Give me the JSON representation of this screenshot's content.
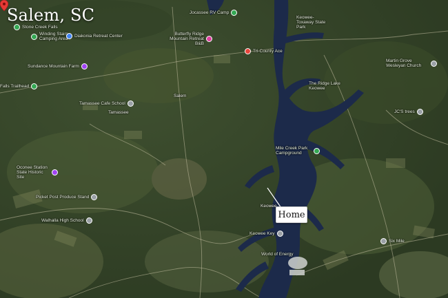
{
  "title": "Salem, SC",
  "marker": {
    "label": "Home"
  },
  "pois": [
    {
      "name": "Stone Creek Falls",
      "color": "#34a853"
    },
    {
      "name": "Winding Stairs Camping Area",
      "color": "#34a853"
    },
    {
      "name": "Diakonia Retreat Center",
      "color": "#4285f4"
    },
    {
      "name": "Butterfly Ridge Mountain Retreat B&B",
      "color": "#e040a0"
    },
    {
      "name": "Sundance Mountain Farm",
      "color": "#a142f4"
    },
    {
      "name": "Jocassee RV Camp",
      "color": "#34a853"
    },
    {
      "name": "Tri-County Ace",
      "color": "#e8453c"
    },
    {
      "name": "Keowee-Toxaway State Park",
      "color": "#34a853"
    },
    {
      "name": "Martin Grove Wesleyan Church",
      "color": "#9aa0a6"
    },
    {
      "name": "The Ridge Lake Keowee",
      "color": "#34a853"
    },
    {
      "name": "Falls Trailhead",
      "color": "#34a853"
    },
    {
      "name": "Tamassee Cafe School",
      "color": "#9aa0a6"
    },
    {
      "name": "JC'S trees",
      "color": "#9aa0a6"
    },
    {
      "name": "Mile Creek Park Campground",
      "color": "#34a853"
    },
    {
      "name": "Oconee Station State Historic Site",
      "color": "#a142f4"
    },
    {
      "name": "Picket Post Produce Stand",
      "color": "#9aa0a6"
    },
    {
      "name": "Walhalla High School",
      "color": "#9aa0a6"
    },
    {
      "name": "Keowee Key",
      "color": "#9aa0a6"
    },
    {
      "name": "World of Energy",
      "color": "#9aa0a6"
    },
    {
      "name": "Six Mile",
      "color": "#9aa0a6"
    }
  ],
  "towns": [
    "Salem",
    "Tamassee",
    "Keowee",
    "Six Mile"
  ]
}
